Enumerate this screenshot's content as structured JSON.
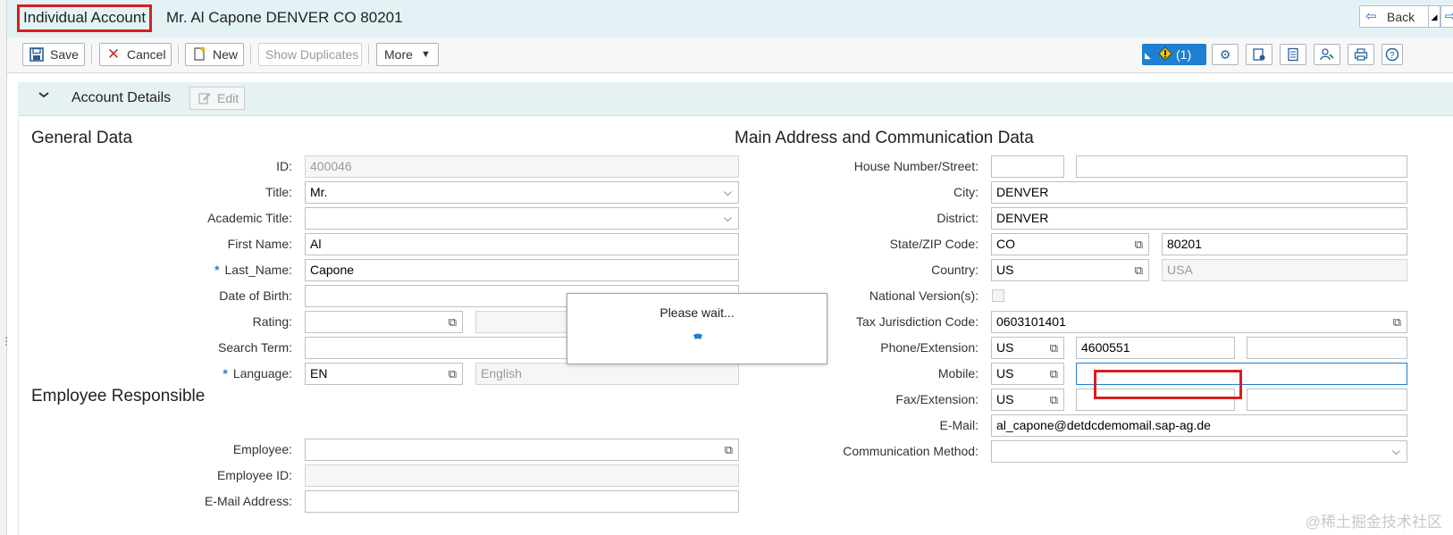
{
  "header": {
    "object_type": "Individual Account",
    "object_name": "Mr. Al Capone DENVER CO 80201",
    "back_label": "Back"
  },
  "toolbar": {
    "save_label": "Save",
    "cancel_label": "Cancel",
    "new_label": "New",
    "show_duplicates_label": "Show Duplicates",
    "more_label": "More",
    "alert_label": "(1)"
  },
  "section": {
    "title": "Account Details",
    "edit_label": "Edit"
  },
  "general": {
    "heading": "General Data",
    "id_label": "ID:",
    "id_value": "400046",
    "title_label": "Title:",
    "title_value": "Mr.",
    "academic_label": "Academic Title:",
    "academic_value": "",
    "first_name_label": "First Name:",
    "first_name_value": "Al",
    "last_name_label": "Last_Name:",
    "last_name_value": "Capone",
    "dob_label": "Date of Birth:",
    "dob_value": "",
    "rating_label": "Rating:",
    "rating_value": "",
    "search_term_label": "Search Term:",
    "search_term_value": "",
    "language_label": "Language:",
    "language_value": "EN",
    "language_desc": "English",
    "required_mark": "*"
  },
  "employee": {
    "heading": "Employee Responsible",
    "employee_label": "Employee:",
    "employee_value": "",
    "employee_id_label": "Employee ID:",
    "employee_id_value": "",
    "email_label": "E-Mail Address:",
    "email_value": ""
  },
  "address": {
    "heading": "Main Address and Communication Data",
    "house_label": "House Number/Street:",
    "house_no": "",
    "street": "",
    "city_label": "City:",
    "city_value": "DENVER",
    "district_label": "District:",
    "district_value": "DENVER",
    "state_label": "State/ZIP Code:",
    "state_value": "CO",
    "zip_value": "80201",
    "country_label": "Country:",
    "country_value": "US",
    "country_desc": "USA",
    "national_label": "National Version(s):",
    "tax_label": "Tax Jurisdiction Code:",
    "tax_value": "0603101401",
    "phone_label": "Phone/Extension:",
    "phone_country": "US",
    "phone_number": "4600551",
    "phone_ext": "",
    "mobile_label": "Mobile:",
    "mobile_country": "US",
    "mobile_number": "",
    "fax_label": "Fax/Extension:",
    "fax_country": "US",
    "fax_number": "",
    "fax_ext": "",
    "email_label": "E-Mail:",
    "email_value": "al_capone@detdcdemomail.sap-ag.de",
    "comm_label": "Communication Method:",
    "comm_value": ""
  },
  "popup": {
    "text": "Please wait..."
  },
  "watermark": "@稀土掘金技术社区",
  "colors": {
    "title_bg": "#e3f2f4",
    "accent_blue": "#1f7fd0",
    "highlight_red": "#d81e1e"
  }
}
